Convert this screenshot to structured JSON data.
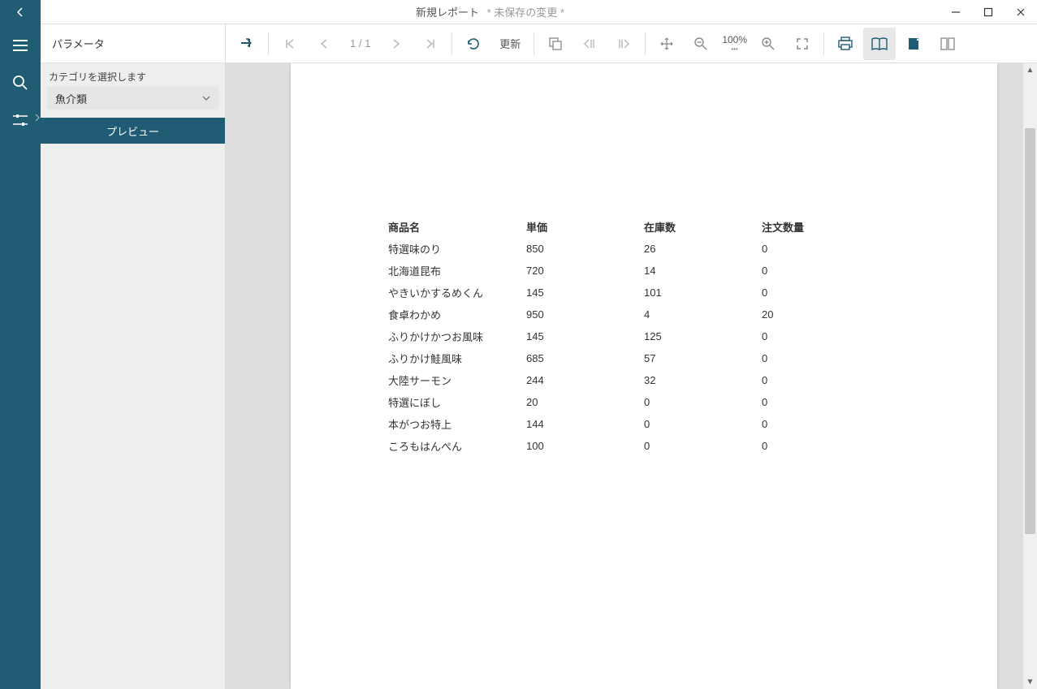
{
  "titlebar": {
    "title": "新規レポート",
    "unsaved": "* 未保存の変更 *"
  },
  "param_panel": {
    "header": "パラメータ",
    "category_label": "カテゴリを選択します",
    "category_value": "魚介類",
    "preview_button": "プレビュー"
  },
  "toolbar": {
    "page_indicator": "1 / 1",
    "refresh_label": "更新",
    "zoom_percent": "100%"
  },
  "report": {
    "headers": {
      "name": "商品名",
      "price": "単価",
      "stock": "在庫数",
      "order_qty": "注文数量"
    },
    "rows": [
      {
        "name": "特選味のり",
        "price": "850",
        "stock": "26",
        "order": "0"
      },
      {
        "name": "北海道昆布",
        "price": "720",
        "stock": "14",
        "order": "0"
      },
      {
        "name": "やきいかするめくん",
        "price": "145",
        "stock": "101",
        "order": "0"
      },
      {
        "name": "食卓わかめ",
        "price": "950",
        "stock": "4",
        "order": "20"
      },
      {
        "name": "ふりかけかつお風味",
        "price": "145",
        "stock": "125",
        "order": "0"
      },
      {
        "name": "ふりかけ鮭風味",
        "price": "685",
        "stock": "57",
        "order": "0"
      },
      {
        "name": "大陸サーモン",
        "price": "244",
        "stock": "32",
        "order": "0"
      },
      {
        "name": "特選にぼし",
        "price": "20",
        "stock": "0",
        "order": "0"
      },
      {
        "name": "本がつお特上",
        "price": "144",
        "stock": "0",
        "order": "0"
      },
      {
        "name": "ころもはんぺん",
        "price": "100",
        "stock": "0",
        "order": "0"
      }
    ]
  }
}
